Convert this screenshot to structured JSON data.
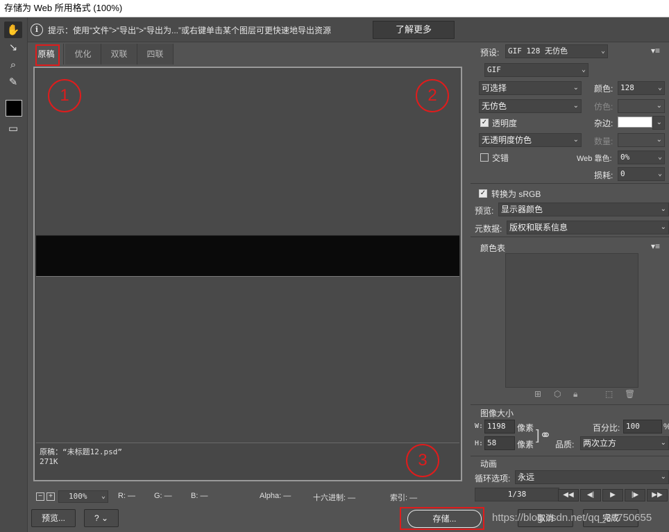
{
  "window": {
    "title": "存储为 Web 所用格式 (100%)"
  },
  "tools": [
    {
      "name": "hand-tool-icon",
      "glyph": "✋"
    },
    {
      "name": "slice-select-icon",
      "glyph": "↘"
    },
    {
      "name": "zoom-icon",
      "glyph": "⌕"
    },
    {
      "name": "eyedropper-icon",
      "glyph": "✎"
    },
    {
      "name": "preview-frame-icon",
      "glyph": "▭"
    }
  ],
  "hint": {
    "text": "提示：使用“文件”>“导出”>“导出为...”或右键单击某个图层可更快速地导出资源",
    "learn_more": "了解更多"
  },
  "tabs": [
    "原稿",
    "优化",
    "双联",
    "四联"
  ],
  "canvas": {
    "info_line1": "原稿：“未标题12.psd”",
    "info_line2": "271K"
  },
  "annotations": [
    "1",
    "2",
    "3"
  ],
  "statusbar": {
    "zoom_minus": "−",
    "zoom_plus": "+",
    "zoom": "100%",
    "r": "R: —",
    "g": "G: —",
    "b": "B: —",
    "alpha": "Alpha: —",
    "hex": "十六进制: —",
    "index": "索引: —"
  },
  "bottom": {
    "preview": "预览...",
    "help_icon": "?",
    "save": "存储...",
    "cancel": "取消",
    "done": "完成"
  },
  "settings": {
    "preset_label": "预设:",
    "preset_value": "GIF 128 无仿色",
    "format": "GIF",
    "reduction": "可选择",
    "dither_algo": "无仿色",
    "transparency_label": "透明度",
    "transparency_checked": true,
    "matte_dither": "无透明度仿色",
    "interlaced_label": "交错",
    "interlaced_checked": false,
    "colors_label": "颜色:",
    "colors_value": "128",
    "dither_label": "仿色:",
    "matte_label": "杂边:",
    "amount_label": "数量:",
    "web_snap_label": "Web 靠色:",
    "web_snap_value": "0%",
    "lossy_label": "损耗:",
    "lossy_value": "0",
    "convert_srgb_label": "转换为 sRGB",
    "convert_srgb_checked": true,
    "preview_label": "预览:",
    "preview_value": "显示器颜色",
    "metadata_label": "元数据:",
    "metadata_value": "版权和联系信息"
  },
  "color_table": {
    "title": "颜色表",
    "icons": [
      "map-icon",
      "cube-icon",
      "lock-icon",
      "new-color-icon",
      "trash-icon"
    ]
  },
  "image_size": {
    "title": "图像大小",
    "w_label": "W:",
    "w_value": "1198",
    "h_label": "H:",
    "h_value": "58",
    "unit": "像素",
    "percent_label": "百分比:",
    "percent_value": "100",
    "percent_unit": "%",
    "quality_label": "品质:",
    "quality_value": "两次立方"
  },
  "animation": {
    "title": "动画",
    "loop_label": "循环选项:",
    "loop_value": "永远",
    "frame": "1/38",
    "controls": [
      "◀◀",
      "◀|",
      "▶",
      "|▶",
      "▶▶"
    ]
  },
  "watermark": "https://blog.csdn.net/qq_37750655"
}
